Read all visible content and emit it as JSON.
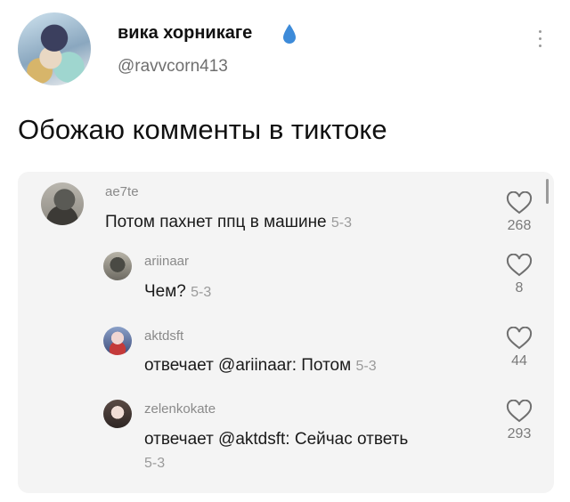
{
  "author": {
    "display_name": "вика хорникаге",
    "handle": "@ravvcorn413",
    "badge_icon": "droplet-icon",
    "badge_color": "#3d8bd9"
  },
  "post": {
    "text": "Обожаю комменты в тиктоке"
  },
  "comments": [
    {
      "username": "ae7te",
      "text": "Потом пахнет ппц в машине",
      "date": "5-3",
      "likes": "268"
    },
    {
      "username": "ariinaar",
      "text": "Чем?",
      "date": "5-3",
      "likes": "8"
    },
    {
      "username": "aktdsft",
      "text": "отвечает @ariinaar: Потом",
      "date": "5-3",
      "likes": "44"
    },
    {
      "username": "zelenkokate",
      "text": "отвечает @aktdsft: Сейчас ответь",
      "date": "5-3",
      "likes": "293"
    }
  ]
}
